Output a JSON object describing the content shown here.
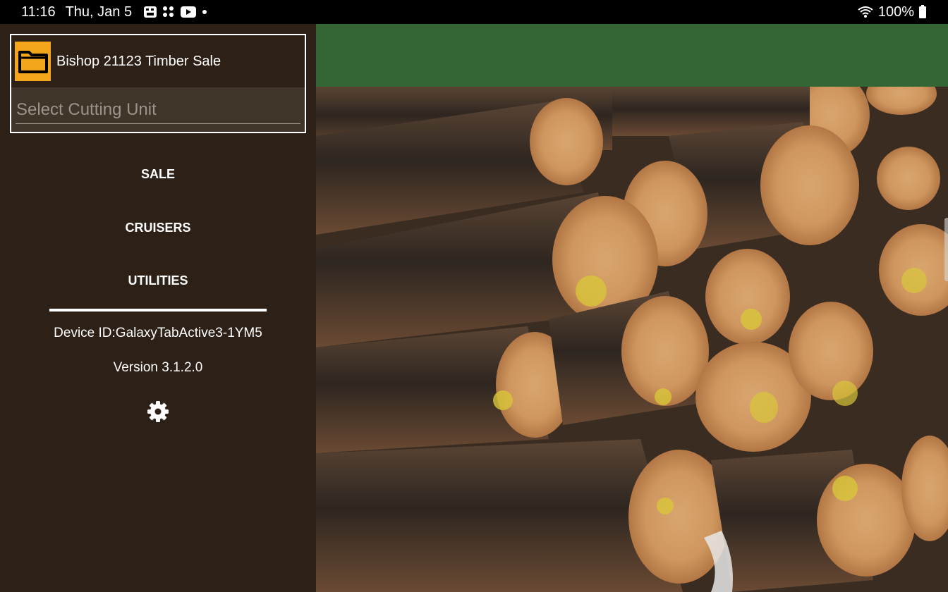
{
  "status_bar": {
    "time": "11:16",
    "date": "Thu, Jan 5",
    "battery": "100%",
    "notification_icons": [
      "photo-icon",
      "apps-grid-icon",
      "youtube-icon",
      "dot-icon"
    ]
  },
  "drawer": {
    "sale_name": "Bishop 21123 Timber Sale",
    "cutting_unit_placeholder": "Select Cutting Unit",
    "nav": {
      "sale": "SALE",
      "cruisers": "CRUISERS",
      "utilities": "UTILITIES"
    },
    "device_id": "Device ID:GalaxyTabActive3-1YM5",
    "version": "Version 3.1.2.0"
  },
  "colors": {
    "drawer_bg": "#2d2117",
    "header_green": "#346534",
    "folder_accent": "#f3a51b",
    "select_bg": "#403529"
  }
}
